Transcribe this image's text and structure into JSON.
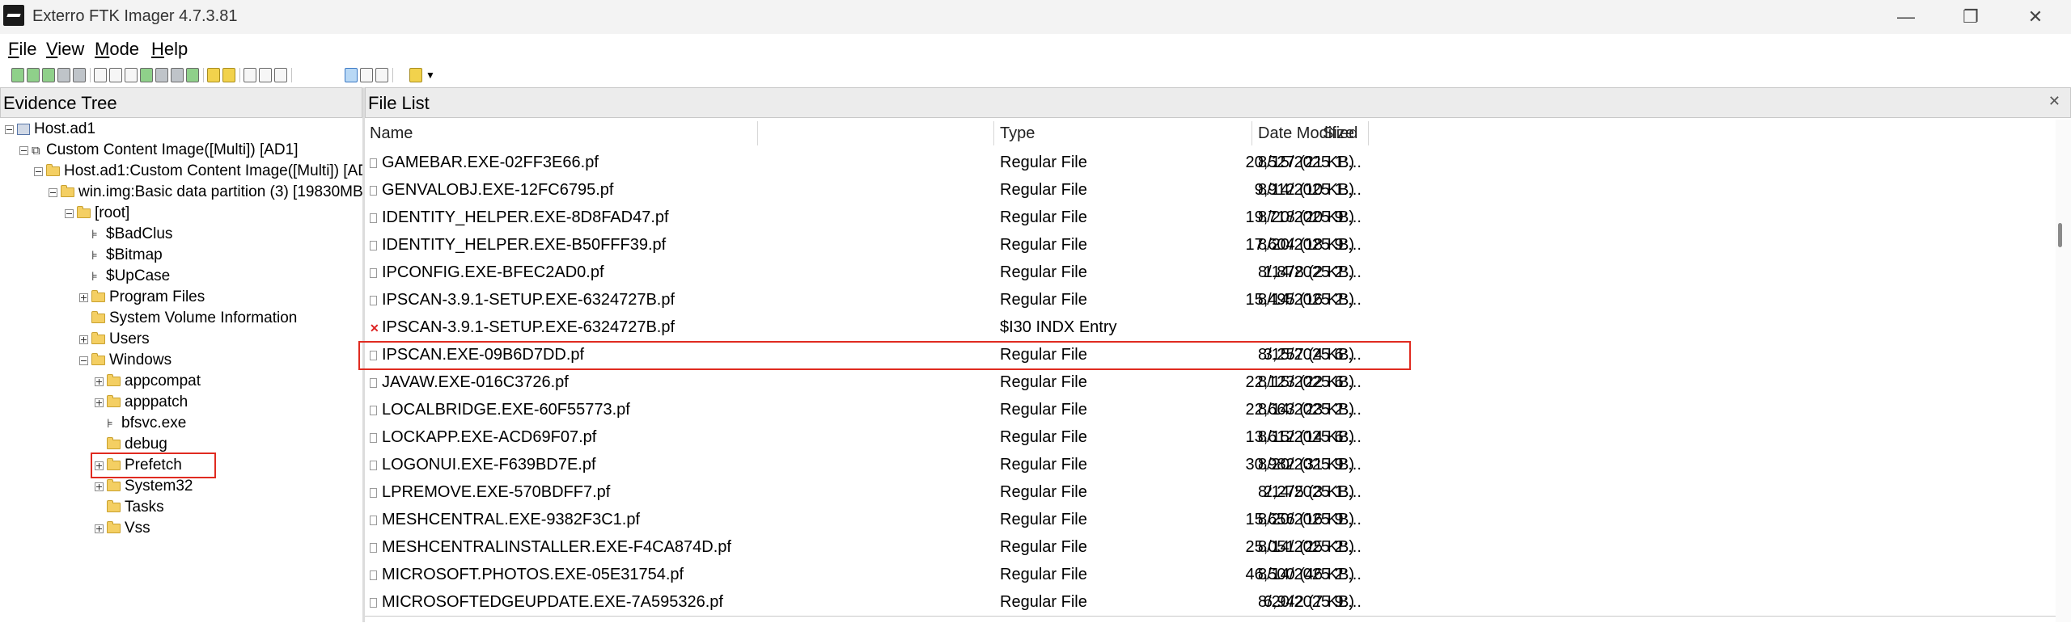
{
  "window": {
    "title": "Exterro FTK Imager 4.7.3.81",
    "minimize": "—",
    "restore": "❐",
    "close": "✕"
  },
  "menu": {
    "file": {
      "accel": "F",
      "rest": "ile"
    },
    "view": {
      "accel": "V",
      "rest": "iew"
    },
    "mode": {
      "accel": "M",
      "rest": "ode"
    },
    "help": {
      "accel": "H",
      "rest": "elp"
    }
  },
  "panes": {
    "evidence_tree": "Evidence Tree",
    "file_list": "File List",
    "close_glyph": "✕"
  },
  "tree": {
    "items": [
      {
        "label": "Host.ad1"
      },
      {
        "label": "Custom Content Image([Multi]) [AD1]"
      },
      {
        "label": "Host.ad1:Custom Content Image([Multi]) [AD"
      },
      {
        "label": "win.img:Basic data partition (3) [19830MB]"
      },
      {
        "label": "[root]"
      },
      {
        "label": "$BadClus"
      },
      {
        "label": "$Bitmap"
      },
      {
        "label": "$UpCase"
      },
      {
        "label": "Program Files"
      },
      {
        "label": "System Volume Information"
      },
      {
        "label": "Users"
      },
      {
        "label": "Windows"
      },
      {
        "label": "appcompat"
      },
      {
        "label": "apppatch"
      },
      {
        "label": "bfsvc.exe"
      },
      {
        "label": "debug"
      },
      {
        "label": "Prefetch",
        "highlighted": true
      },
      {
        "label": "System32"
      },
      {
        "label": "Tasks"
      },
      {
        "label": "Vss"
      }
    ]
  },
  "file_list": {
    "columns": {
      "name": "Name",
      "size": "Size",
      "type": "Type",
      "date": "Date Modified"
    },
    "rows": [
      {
        "name": "GAMEBAR.EXE-02FF3E66.pf",
        "size": "20,527 (21 KB)",
        "type": "Regular File",
        "date": "8/15/2025 1:..."
      },
      {
        "name": "GENVALOBJ.EXE-12FC6795.pf",
        "size": "9,912 (10 KB)",
        "type": "Regular File",
        "date": "8/14/2025 1:..."
      },
      {
        "name": "IDENTITY_HELPER.EXE-8D8FAD47.pf",
        "size": "19,718 (20 KB)",
        "type": "Regular File",
        "date": "8/20/2025 9:..."
      },
      {
        "name": "IDENTITY_HELPER.EXE-B50FFF39.pf",
        "size": "17,604 (18 KB)",
        "type": "Regular File",
        "date": "8/20/2025 9:..."
      },
      {
        "name": "IPCONFIG.EXE-BFEC2AD0.pf",
        "size": "1,878 (2 KB)",
        "type": "Regular File",
        "date": "8/14/2025 2:..."
      },
      {
        "name": "IPSCAN-3.9.1-SETUP.EXE-6324727B.pf",
        "size": "15,495 (16 KB)",
        "type": "Regular File",
        "date": "8/14/2025 2:..."
      },
      {
        "name": "IPSCAN-3.9.1-SETUP.EXE-6324727B.pf",
        "size": "",
        "type": "$I30 INDX Entry",
        "date": "",
        "deleted": true
      },
      {
        "name": "IPSCAN.EXE-09B6D7DD.pf",
        "size": "3,257 (4 KB)",
        "type": "Regular File",
        "date": "8/15/2025 6:...",
        "highlighted": true
      },
      {
        "name": "JAVAW.EXE-016C3726.pf",
        "size": "22,123 (22 KB)",
        "type": "Regular File",
        "date": "8/15/2025 6:..."
      },
      {
        "name": "LOCALBRIDGE.EXE-60F55773.pf",
        "size": "22,663 (23 KB)",
        "type": "Regular File",
        "date": "8/14/2025 2:..."
      },
      {
        "name": "LOCKAPP.EXE-ACD69F07.pf",
        "size": "13,612 (14 KB)",
        "type": "Regular File",
        "date": "8/15/2025 6:..."
      },
      {
        "name": "LOGONUI.EXE-F639BD7E.pf",
        "size": "30,982 (31 KB)",
        "type": "Regular File",
        "date": "8/20/2025 9:..."
      },
      {
        "name": "LPREMOVE.EXE-570BDFF7.pf",
        "size": "2,275 (3 KB)",
        "type": "Regular File",
        "date": "8/14/2025 1:..."
      },
      {
        "name": "MESHCENTRAL.EXE-9382F3C1.pf",
        "size": "15,656 (16 KB)",
        "type": "Regular File",
        "date": "8/20/2025 9:..."
      },
      {
        "name": "MESHCENTRALINSTALLER.EXE-F4CA874D.pf",
        "size": "25,051 (25 KB)",
        "type": "Regular File",
        "date": "8/14/2025 2:..."
      },
      {
        "name": "MICROSOFT.PHOTOS.EXE-05E31754.pf",
        "size": "46,500 (46 KB)",
        "type": "Regular File",
        "date": "8/14/2025 2:..."
      },
      {
        "name": "MICROSOFTEDGEUPDATE.EXE-7A595326.pf",
        "size": "6,942 (7 KB)",
        "type": "Regular File",
        "date": "8/20/2025 9:..."
      }
    ]
  }
}
